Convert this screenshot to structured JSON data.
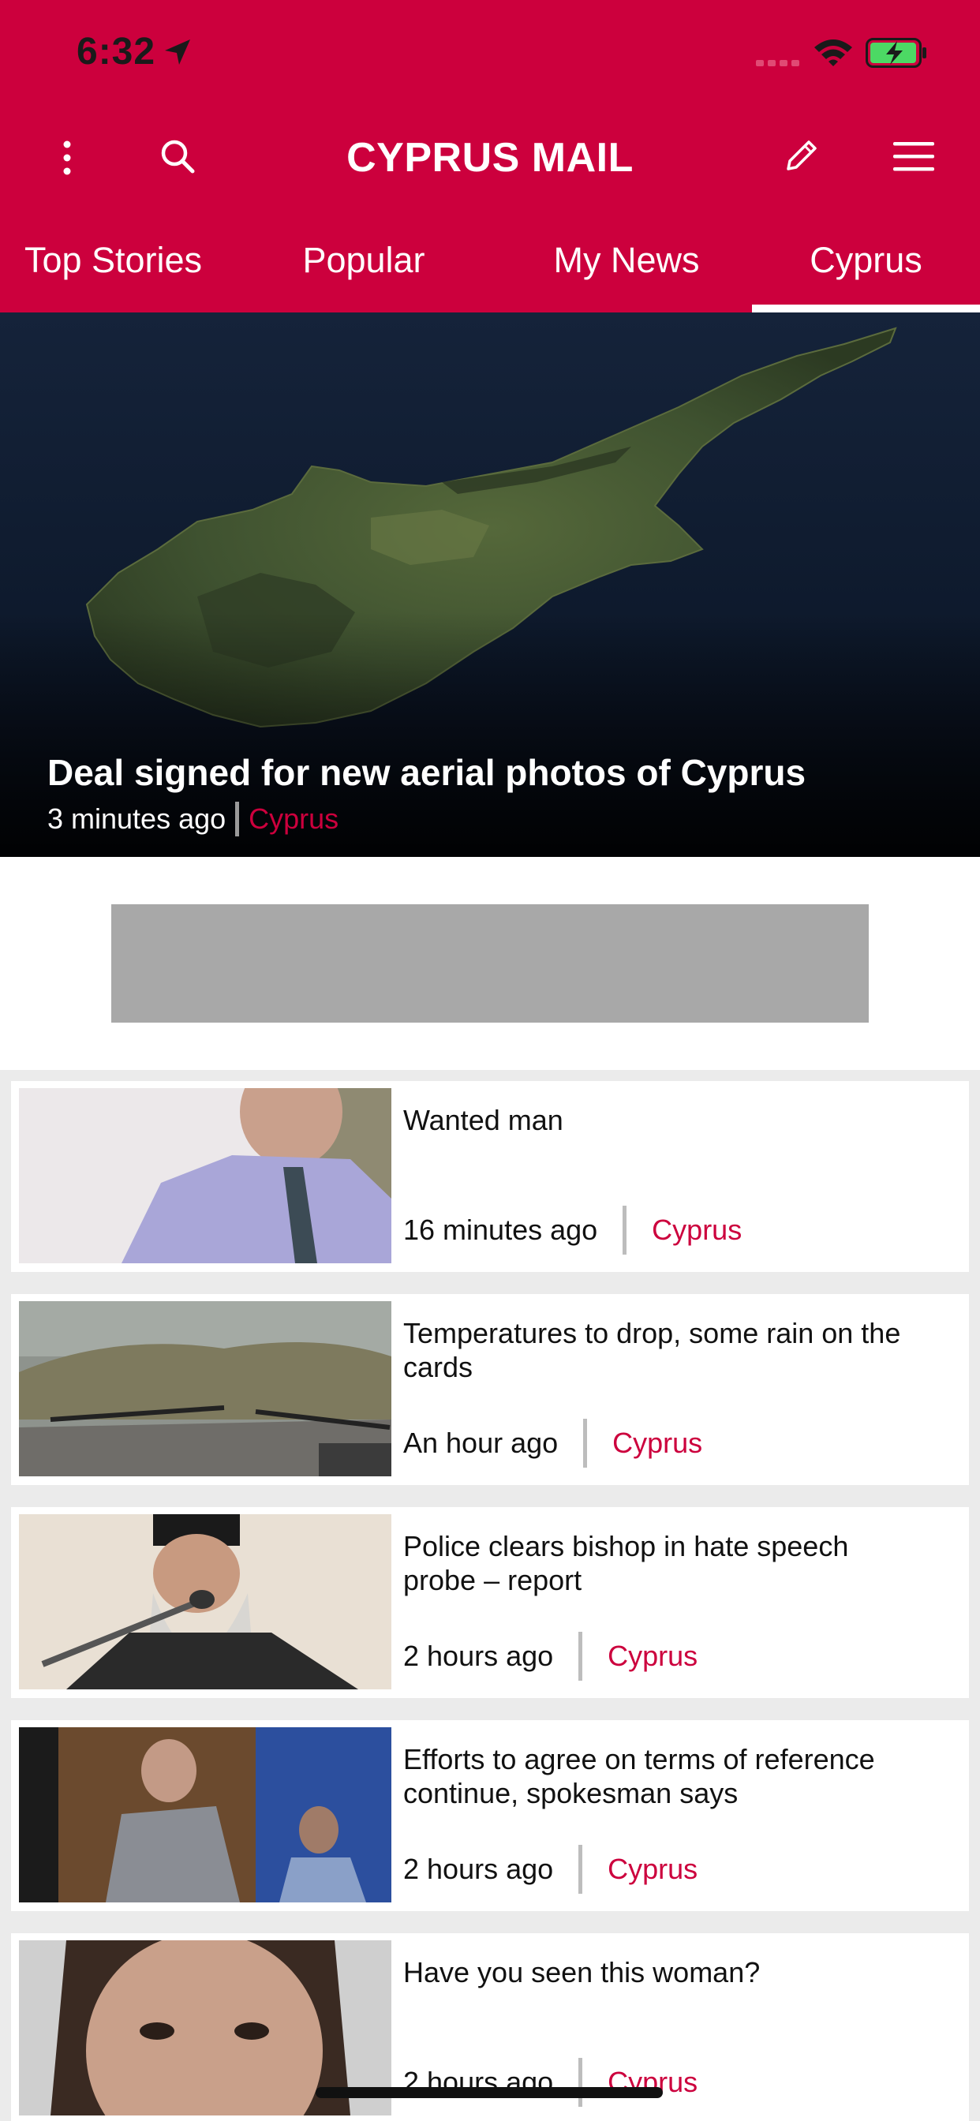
{
  "status": {
    "time": "6:32"
  },
  "app": {
    "title": "CYPRUS MAIL"
  },
  "tabs": [
    {
      "label": "Top Stories",
      "active": false
    },
    {
      "label": "Popular",
      "active": false
    },
    {
      "label": "My News",
      "active": false
    },
    {
      "label": "Cyprus",
      "active": true
    }
  ],
  "hero": {
    "title": "Deal signed for new aerial photos of Cyprus",
    "time": "3 minutes ago",
    "category": "Cyprus"
  },
  "articles": [
    {
      "title": "Wanted man",
      "time": "16 minutes ago",
      "category": "Cyprus"
    },
    {
      "title": "Temperatures to drop, some rain on the cards",
      "time": "An hour ago",
      "category": "Cyprus"
    },
    {
      "title": "Police clears bishop in hate speech probe – report",
      "time": "2 hours ago",
      "category": "Cyprus"
    },
    {
      "title": "Efforts to agree on terms of reference continue, spokesman says",
      "time": "2 hours ago",
      "category": "Cyprus"
    },
    {
      "title": "Have you seen this woman?",
      "time": "2 hours ago",
      "category": "Cyprus"
    }
  ],
  "colors": {
    "brand": "#cc003d",
    "ad_placeholder": "#a8a8a8",
    "list_background": "#ebebeb"
  },
  "icons": [
    "location-arrow-icon",
    "signal-icon",
    "wifi-icon",
    "battery-charging-icon",
    "more-vertical-icon",
    "search-icon",
    "pencil-icon",
    "hamburger-menu-icon"
  ]
}
